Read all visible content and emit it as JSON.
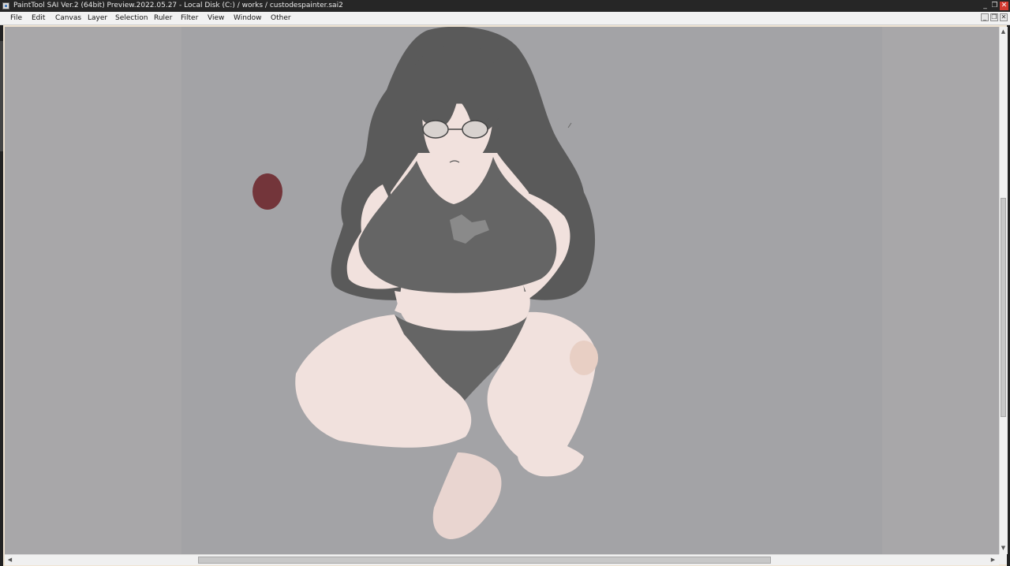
{
  "window": {
    "title": "PaintTool SAI Ver.2 (64bit) Preview.2022.05.27 - Local Disk (C:) / works / custodespainter.sai2",
    "controls": {
      "minimize": "_",
      "restore": "❐",
      "close": "✕"
    }
  },
  "menubar": {
    "items": [
      "File",
      "Edit",
      "Canvas",
      "Layer",
      "Selection",
      "Ruler",
      "Filter",
      "View",
      "Window",
      "Other"
    ]
  },
  "document_controls": {
    "minimize": "_",
    "restore": "❐",
    "close": "✕"
  },
  "scrollbars": {
    "vertical": {
      "up": "▲",
      "down": "▼",
      "position_fraction": 0.33,
      "visible_fraction": 0.42
    },
    "horizontal": {
      "left": "◀",
      "right": "▶",
      "position_fraction": 0.19,
      "visible_fraction": 0.58
    }
  },
  "colors": {
    "titlebar": "#262626",
    "close_button": "#d33a30",
    "menubar": "#f2f2f2",
    "canvas_background": "#a8a7a9",
    "paper": "#a3a3a6",
    "skin": "#f1e1dd",
    "hair": "#5a5a5a",
    "paint_dot": "#73353a"
  },
  "icons": {
    "app": "painttool-sai-icon",
    "minimize": "minimize-icon",
    "restore": "restore-icon",
    "close": "close-icon"
  }
}
